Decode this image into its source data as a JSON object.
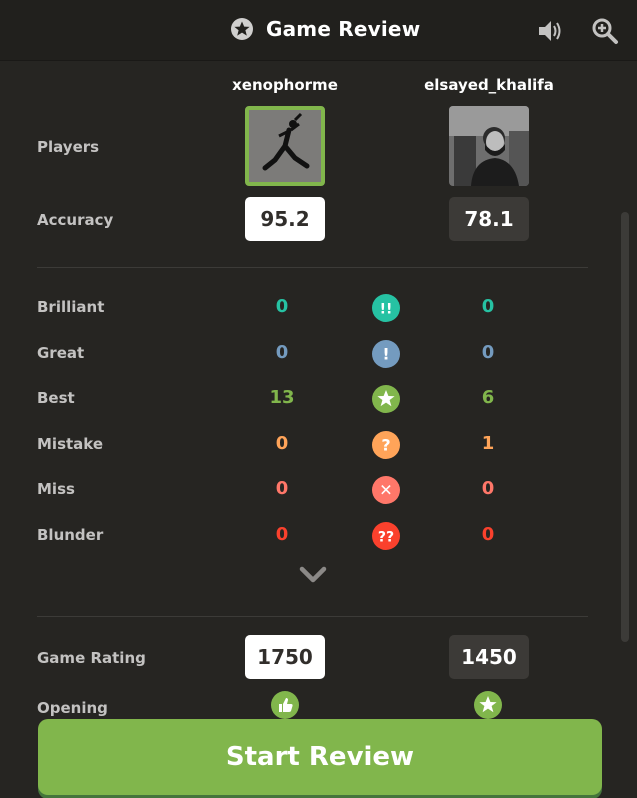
{
  "header": {
    "title": "Game Review",
    "title_icon": "star-badge-icon",
    "sound_icon": "speaker-icon",
    "zoom_icon": "magnifier-plus-icon"
  },
  "players": {
    "label": "Players",
    "white": {
      "name": "xenophorme",
      "avatar": "jumpman-silhouette-image"
    },
    "black": {
      "name": "elsayed_khalifa",
      "avatar": "photo-man-portrait"
    }
  },
  "accuracy": {
    "label": "Accuracy",
    "white": "95.2",
    "black": "78.1"
  },
  "classifications": [
    {
      "label": "Brilliant",
      "white": "0",
      "black": "0",
      "color": "#26c2a3",
      "icon": "brilliant-icon",
      "symbol": "!!"
    },
    {
      "label": "Great",
      "white": "0",
      "black": "0",
      "color": "#749bbf",
      "icon": "great-icon",
      "symbol": "!"
    },
    {
      "label": "Best",
      "white": "13",
      "black": "6",
      "color": "#81b64c",
      "icon": "best-star-icon",
      "symbol": "★"
    },
    {
      "label": "Mistake",
      "white": "0",
      "black": "1",
      "color": "#ffa459",
      "icon": "mistake-icon",
      "symbol": "?"
    },
    {
      "label": "Miss",
      "white": "0",
      "black": "0",
      "color": "#ff7769",
      "icon": "miss-icon",
      "symbol": "✕"
    },
    {
      "label": "Blunder",
      "white": "0",
      "black": "0",
      "color": "#fa412d",
      "icon": "blunder-icon",
      "symbol": "??"
    }
  ],
  "expand_icon": "chevron-down-icon",
  "game_rating": {
    "label": "Game Rating",
    "white": "1750",
    "black": "1450"
  },
  "opening": {
    "label": "Opening",
    "white_icon": "thumbs-up-icon",
    "black_icon": "best-star-icon"
  },
  "start_button": "Start Review",
  "colors": {
    "accent": "#81b64c",
    "background": "#262522",
    "header": "#21201d"
  }
}
